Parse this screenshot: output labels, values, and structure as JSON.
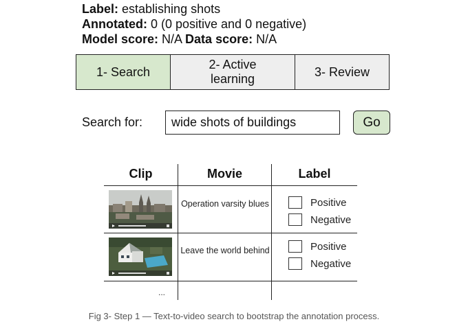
{
  "header": {
    "label_key": "Label:",
    "label_value": " establishing shots",
    "annotated_key": "Annotated:",
    "annotated_value": " 0 (0 positive and 0 negative)",
    "model_score_key": "Model score:",
    "model_score_value": " N/A ",
    "data_score_key": "Data score:",
    "data_score_value": " N/A"
  },
  "tabs": [
    {
      "label": "1- Search",
      "active": true
    },
    {
      "label": "2- Active learning",
      "active": false
    },
    {
      "label": "3- Review",
      "active": false
    }
  ],
  "search": {
    "label": "Search for:",
    "value": "wide shots of buildings",
    "button_label": "Go"
  },
  "table": {
    "headers": {
      "clip": "Clip",
      "movie": "Movie",
      "label": "Label"
    },
    "rows": [
      {
        "movie": "Operation varsity blues",
        "options": [
          "Positive",
          "Negative"
        ],
        "thumbnail": "city-skyline-thumbnail"
      },
      {
        "movie": "Leave the world behind",
        "options": [
          "Positive",
          "Negative"
        ],
        "thumbnail": "house-aerial-thumbnail"
      }
    ],
    "more": "..."
  },
  "caption": "Fig 3- Step 1 — Text-to-video search to bootstrap the annotation process.",
  "colors": {
    "active_tab": "#d7e8cd",
    "inactive_tab": "#eeeeee",
    "go_button": "#d7e8cd"
  }
}
